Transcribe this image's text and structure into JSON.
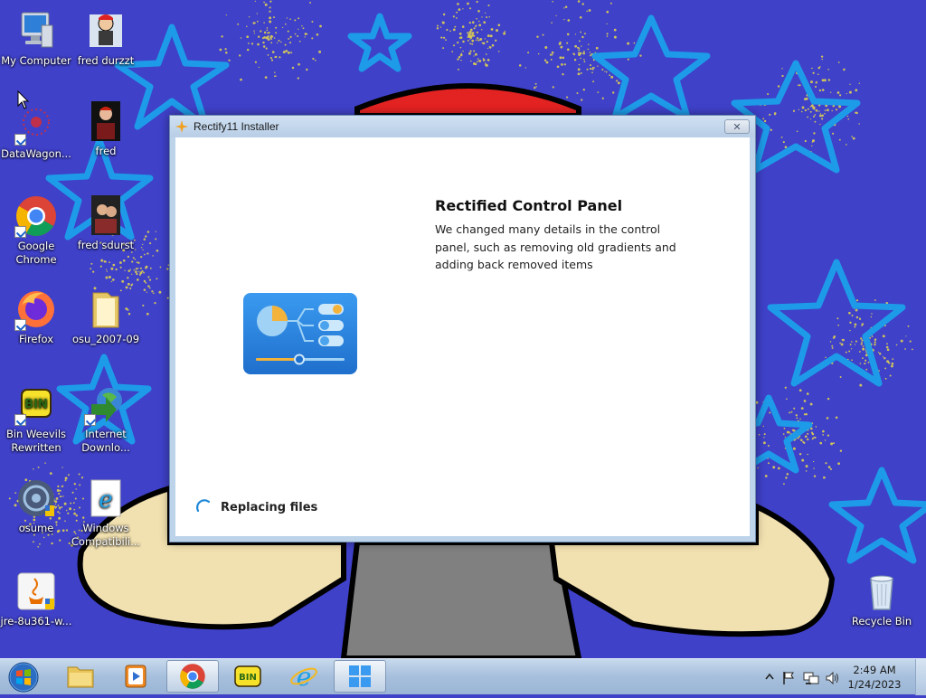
{
  "desktop": {
    "icons": [
      {
        "label": "My Computer",
        "icon": "computer-icon"
      },
      {
        "label": "fred durzzt",
        "icon": "user-picture-icon"
      },
      {
        "label": "DataWagon...",
        "icon": "datawagon-icon"
      },
      {
        "label": "fred",
        "icon": "user-picture-icon"
      },
      {
        "label": "Google Chrome",
        "icon": "chrome-icon"
      },
      {
        "label": "fred sdurst",
        "icon": "user-picture-icon"
      },
      {
        "label": "Firefox",
        "icon": "firefox-icon"
      },
      {
        "label": "osu_2007-09",
        "icon": "folder-icon"
      },
      {
        "label": "Bin Weevils Rewritten",
        "icon": "bin-weevils-icon"
      },
      {
        "label": "Internet Downlo...",
        "icon": "download-manager-icon"
      },
      {
        "label": "osume",
        "icon": "osume-icon"
      },
      {
        "label": "Windows Compatibili...",
        "icon": "ie-icon"
      },
      {
        "label": "jre-8u361-w...",
        "icon": "java-icon"
      },
      {
        "label": "Recycle Bin",
        "icon": "recycle-bin-icon"
      }
    ]
  },
  "installer": {
    "title": "Rectify11 Installer",
    "close_label": "✕",
    "feature_title": "Rectified Control Panel",
    "feature_description": "We changed many details in the control panel, such as removing old gradients and adding back removed items",
    "status": "Replacing files",
    "feature_icon": "control-panel-icon"
  },
  "taskbar": {
    "start": "windows-start-icon",
    "pinned": [
      {
        "name": "explorer",
        "icon": "folder-icon",
        "active": false
      },
      {
        "name": "media player",
        "icon": "media-player-icon",
        "active": false
      },
      {
        "name": "chrome",
        "icon": "chrome-icon",
        "active": true
      },
      {
        "name": "bin weevils",
        "icon": "bin-weevils-icon",
        "active": false
      },
      {
        "name": "internet explorer",
        "icon": "ie-icon",
        "active": false
      },
      {
        "name": "rectify11 installer",
        "icon": "rectify11-icon",
        "active": true
      }
    ],
    "tray": {
      "time": "2:49 AM",
      "date": "1/24/2023"
    }
  },
  "colors": {
    "wallpaper_blue": "#3f41c9",
    "accent_blue": "#1e88d6",
    "control_panel_blue": "#2a7fd6"
  }
}
